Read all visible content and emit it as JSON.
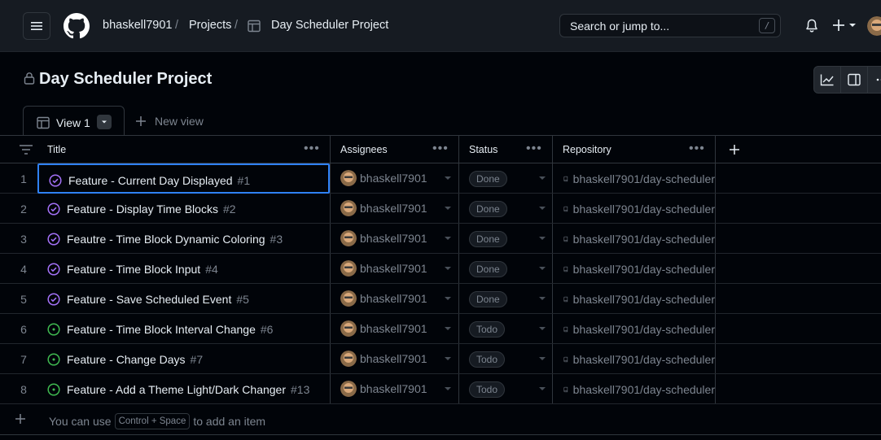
{
  "header": {
    "user": "bhaskell7901",
    "projects_label": "Projects",
    "project_crumb": "Day Scheduler Project",
    "separator": "/",
    "search_placeholder": "Search or jump to...",
    "search_key": "/"
  },
  "project": {
    "title": "Day Scheduler Project"
  },
  "tabs": {
    "active_label": "View 1",
    "new_view_label": "New view"
  },
  "columns": {
    "title": "Title",
    "assignees": "Assignees",
    "status": "Status",
    "repository": "Repository"
  },
  "rows": [
    {
      "num": "1",
      "title": "Feature - Current Day Displayed",
      "issue": "#1",
      "assignee": "bhaskell7901",
      "status": "Done",
      "repo": "bhaskell7901/day-scheduler",
      "state": "closed"
    },
    {
      "num": "2",
      "title": "Feature - Display Time Blocks",
      "issue": "#2",
      "assignee": "bhaskell7901",
      "status": "Done",
      "repo": "bhaskell7901/day-scheduler",
      "state": "closed"
    },
    {
      "num": "3",
      "title": "Feautre - Time Block Dynamic Coloring",
      "issue": "#3",
      "assignee": "bhaskell7901",
      "status": "Done",
      "repo": "bhaskell7901/day-scheduler",
      "state": "closed"
    },
    {
      "num": "4",
      "title": "Feature - Time Block Input",
      "issue": "#4",
      "assignee": "bhaskell7901",
      "status": "Done",
      "repo": "bhaskell7901/day-scheduler",
      "state": "closed"
    },
    {
      "num": "5",
      "title": "Feature - Save Scheduled Event",
      "issue": "#5",
      "assignee": "bhaskell7901",
      "status": "Done",
      "repo": "bhaskell7901/day-scheduler",
      "state": "closed"
    },
    {
      "num": "6",
      "title": "Feature - Time Block Interval Change",
      "issue": "#6",
      "assignee": "bhaskell7901",
      "status": "Todo",
      "repo": "bhaskell7901/day-scheduler",
      "state": "open"
    },
    {
      "num": "7",
      "title": "Feature - Change Days",
      "issue": "#7",
      "assignee": "bhaskell7901",
      "status": "Todo",
      "repo": "bhaskell7901/day-scheduler",
      "state": "open"
    },
    {
      "num": "8",
      "title": "Feature - Add a Theme Light/Dark Changer",
      "issue": "#13",
      "assignee": "bhaskell7901",
      "status": "Todo",
      "repo": "bhaskell7901/day-scheduler",
      "state": "open"
    }
  ],
  "add_item": {
    "prefix": "You can use",
    "shortcut": "Control + Space",
    "suffix": "to add an item"
  },
  "colors": {
    "closed_issue": "#a371f7",
    "open_issue": "#3fb950",
    "focus": "#2f81f7"
  }
}
